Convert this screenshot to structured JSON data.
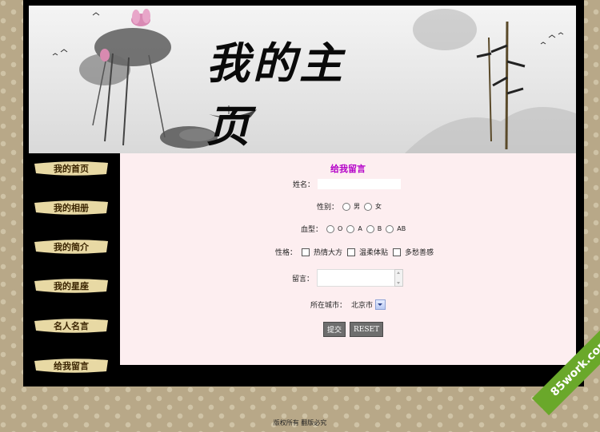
{
  "banner": {
    "title": "我的主页"
  },
  "sidebar": {
    "items": [
      {
        "label": "我的首页"
      },
      {
        "label": "我的相册"
      },
      {
        "label": "我的简介"
      },
      {
        "label": "我的星座"
      },
      {
        "label": "名人名言"
      },
      {
        "label": "给我留言"
      }
    ]
  },
  "form": {
    "title": "给我留言",
    "name_label": "姓名：",
    "name_value": "",
    "gender_label": "性别：",
    "gender_options": [
      "男",
      "女"
    ],
    "blood_label": "血型：",
    "blood_options": [
      "O",
      "A",
      "B",
      "AB"
    ],
    "personality_label": "性格：",
    "personality_options": [
      "热情大方",
      "温柔体贴",
      "多愁善感"
    ],
    "message_label": "留言：",
    "message_value": "",
    "city_label": "所在城市：",
    "city_selected": "北京市",
    "submit_label": "提交",
    "reset_label": "RESET"
  },
  "footer": {
    "text": "版权所有 翻版必究"
  },
  "watermark": {
    "text": "85work.com"
  }
}
